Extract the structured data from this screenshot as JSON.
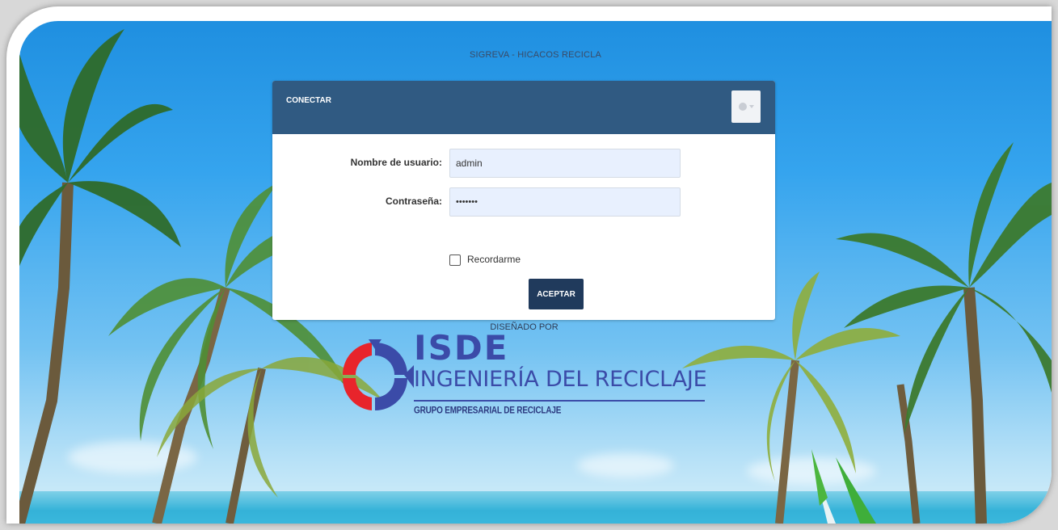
{
  "app_title": "SIGREVA - HICACOS RECICLA",
  "login_panel": {
    "title": "CONECTAR",
    "language_icon": "globe-icon",
    "fields": {
      "username": {
        "label": "Nombre de usuario:",
        "value": "admin"
      },
      "password": {
        "label": "Contraseña:",
        "value": "•••••••"
      }
    },
    "remember_label": "Recordarme",
    "remember_checked": false,
    "submit_label": "ACEPTAR"
  },
  "footer": {
    "designed_by": "DISEÑADO POR",
    "logo": {
      "name": "ISDE",
      "tagline": "INGENIERÍA DEL RECICLAJE",
      "subtitle": "GRUPO EMPRESARIAL DE RECICLAJE"
    }
  },
  "colors": {
    "header": "#305a82",
    "button": "#203a5c",
    "input_bg": "#e8f0fe",
    "logo_blue": "#3b4ba8",
    "logo_red": "#e8242b"
  }
}
